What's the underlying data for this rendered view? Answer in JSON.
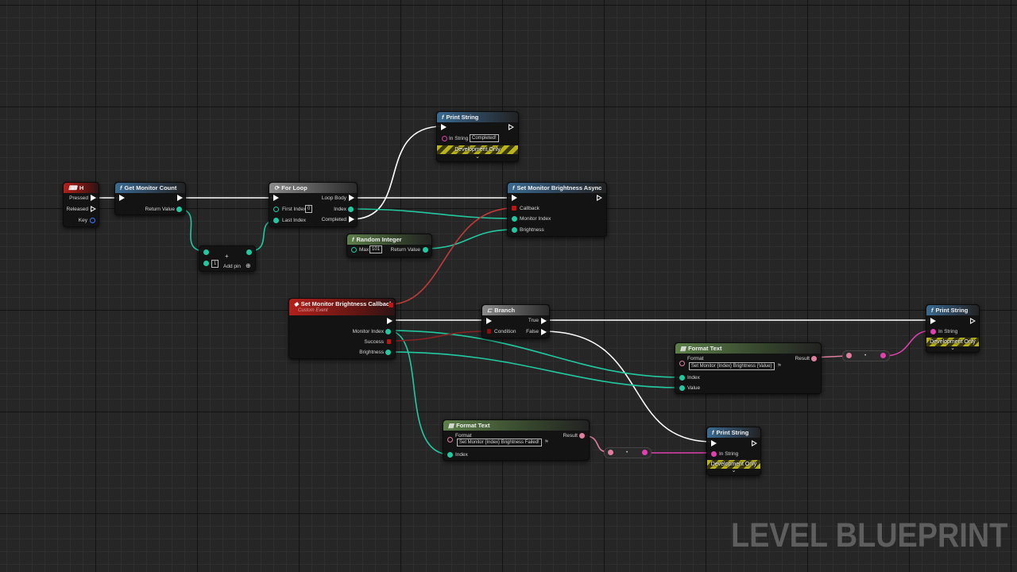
{
  "watermark": "LEVEL BLUEPRINT",
  "colors": {
    "function_header": "#3a6a91",
    "event_header": "#b2201c",
    "pure_header": "#5d7f4a",
    "integer_pin": "#22c9a0",
    "string_pin": "#e040b0",
    "text_pin": "#e07ea0",
    "bool_pin": "#c01515",
    "delegate_pin": "#c01515"
  },
  "nodes": {
    "key_event": {
      "title": "H",
      "icon": "keyboard-icon",
      "pins": {
        "pressed": "Pressed",
        "released": "Released",
        "key": "Key"
      }
    },
    "get_monitor_count": {
      "title": "Get Monitor Count",
      "icon": "function-icon",
      "pins": {
        "return_value": "Return Value"
      }
    },
    "add_node": {
      "symbol": "+",
      "b_value": "1",
      "add_pin": "Add pin"
    },
    "for_loop": {
      "title": "For Loop",
      "icon": "macro-icon",
      "pins": {
        "loop_body": "Loop Body",
        "first_index": "First Index",
        "first_index_value": "0",
        "last_index": "Last Index",
        "index": "Index",
        "completed": "Completed"
      }
    },
    "print_string_completed": {
      "title": "Print String",
      "icon": "function-icon",
      "pins": {
        "in_string": "In String",
        "in_string_value": "Completed!"
      },
      "dev_only": "Development Only"
    },
    "set_brightness_async": {
      "title": "Set Monitor Brightness Async",
      "icon": "function-icon",
      "pins": {
        "callback": "Callback",
        "monitor_index": "Monitor Index",
        "brightness": "Brightness"
      }
    },
    "random_integer": {
      "title": "Random Integer",
      "icon": "function-icon",
      "pins": {
        "max": "Max",
        "max_value": "101",
        "return_value": "Return Value"
      }
    },
    "callback_event": {
      "title": "Set Monitor Brightness Callback",
      "subtitle": "Custom Event",
      "icon": "event-icon",
      "pins": {
        "monitor_index": "Monitor Index",
        "success": "Success",
        "brightness": "Brightness"
      }
    },
    "branch": {
      "title": "Branch",
      "icon": "branch-icon",
      "pins": {
        "condition": "Condition",
        "true": "True",
        "false": "False"
      }
    },
    "format_text_success": {
      "title": "Format Text",
      "icon": "text-icon",
      "pins": {
        "format": "Format",
        "format_value": "Set Monitor {Index} Brightness {Value}",
        "index": "Index",
        "value": "Value",
        "result": "Result"
      }
    },
    "print_string_success": {
      "title": "Print String",
      "icon": "function-icon",
      "pins": {
        "in_string": "In String"
      },
      "dev_only": "Development Only"
    },
    "format_text_failed": {
      "title": "Format Text",
      "icon": "text-icon",
      "pins": {
        "format": "Format",
        "format_value": "Set Monitor {Index} Brightness Failed!",
        "index": "Index",
        "result": "Result"
      }
    },
    "print_string_failed": {
      "title": "Print String",
      "icon": "function-icon",
      "pins": {
        "in_string": "In String"
      },
      "dev_only": "Development Only"
    }
  }
}
